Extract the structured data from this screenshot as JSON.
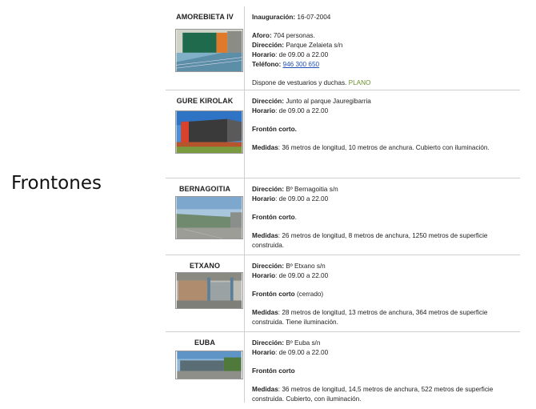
{
  "side_title": "Frontones",
  "facilities": [
    {
      "name": "AMOREBIETA IV",
      "inauguracion_label": "Inauguración:",
      "inauguracion": "16-07-2004",
      "aforo_label": "Aforo:",
      "aforo": "704 personas.",
      "direccion_label": "Dirección:",
      "direccion": "Parque Zelaieta s/n",
      "horario_label": "Horario",
      "horario": ": de 09.00 a 22.00",
      "telefono_label": "Teléfono:",
      "telefono": "946 300 650",
      "nota": "Dispone de vestuarios y duchas.",
      "plano": "PLANO"
    },
    {
      "name": "GURE KIROLAK",
      "direccion_label": "Dirección:",
      "direccion": "Junto al parque Jauregibarria",
      "horario_label": "Horario",
      "horario": ": de 09.00 a 22.00",
      "tipo": "Frontón corto.",
      "medidas_label": "Medidas",
      "medidas": ": 36 metros de longitud, 10 metros de anchura. Cubierto con iluminación."
    },
    {
      "name": "BERNAGOITIA",
      "direccion_label": "Dirección:",
      "direccion": "Bº Bernagoitia s/n",
      "horario_label": "Horario",
      "horario": ": de 09.00 a 22.00",
      "tipo": "Frontón corto",
      "tipo_extra": ".",
      "medidas_label": "Medidas",
      "medidas": ": 26 metros de longitud, 8 metros de anchura, 1250 metros de superficie construida."
    },
    {
      "name": "ETXANO",
      "direccion_label": "Dirección:",
      "direccion": "Bº Etxano s/n",
      "horario_label": "Horario",
      "horario": ": de 09.00 a 22.00",
      "tipo": "Frontón corto",
      "tipo_extra": " (cerrado)",
      "medidas_label": "Medidas",
      "medidas": ": 28 metros de longitud, 13 metros de anchura, 364 metros de superficie construida. Tiene iluminación."
    },
    {
      "name": "EUBA",
      "direccion_label": "Dirección:",
      "direccion": "Bº Euba s/n",
      "horario_label": "Horario",
      "horario": ": de 09.00 a 22.00",
      "tipo": "Frontón corto",
      "medidas_label": "Medidas",
      "medidas": ": 36 metros de longitud, 14,5 metros de anchura, 522 metros de superficie construida. Cubierto, con iluminación."
    }
  ]
}
